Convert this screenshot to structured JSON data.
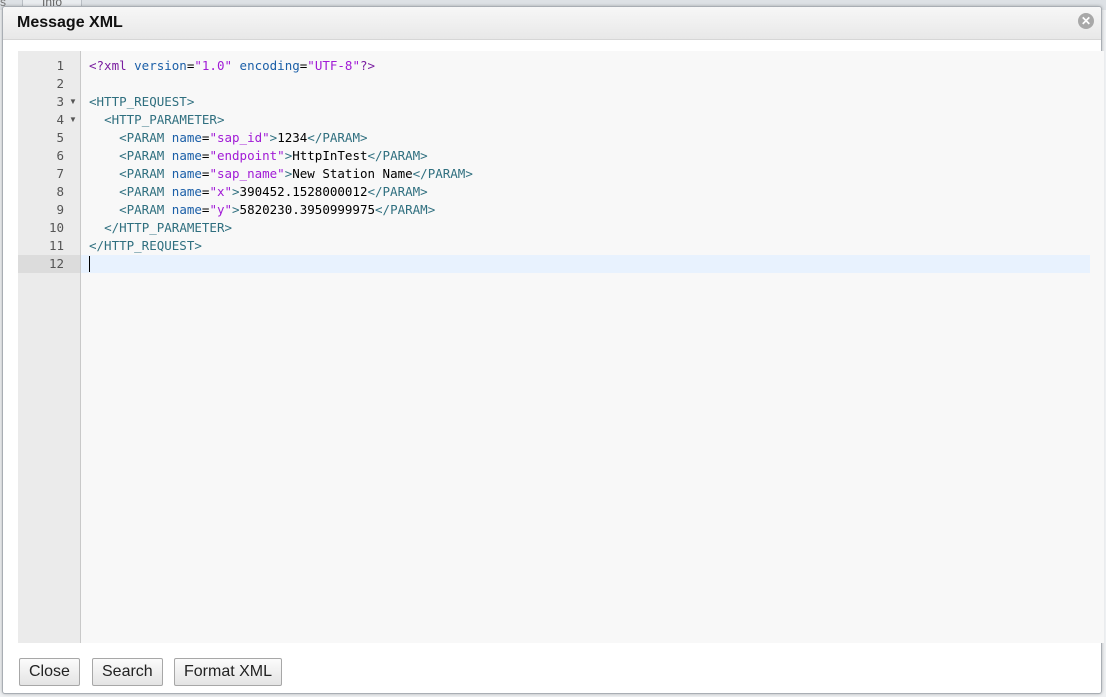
{
  "background": {
    "tab_fragment": "Info",
    "left_fragment": "s"
  },
  "dialog": {
    "title": "Message XML",
    "close_icon": "close-circle-icon"
  },
  "editor": {
    "active_line": 12,
    "lines": [
      {
        "n": "1",
        "fold": "",
        "tokens": [
          [
            "xml",
            "<?xml "
          ],
          [
            "attr",
            "version"
          ],
          [
            "txt",
            "="
          ],
          [
            "str",
            "\"1.0\""
          ],
          [
            "txt",
            " "
          ],
          [
            "attr",
            "encoding"
          ],
          [
            "txt",
            "="
          ],
          [
            "str",
            "\"UTF-8\""
          ],
          [
            "xml",
            "?>"
          ]
        ]
      },
      {
        "n": "2",
        "fold": "",
        "tokens": []
      },
      {
        "n": "3",
        "fold": "▼",
        "tokens": [
          [
            "tag",
            "<HTTP_REQUEST>"
          ]
        ]
      },
      {
        "n": "4",
        "fold": "▼",
        "tokens": [
          [
            "txt",
            "  "
          ],
          [
            "tag",
            "<HTTP_PARAMETER>"
          ]
        ]
      },
      {
        "n": "5",
        "fold": "",
        "tokens": [
          [
            "txt",
            "    "
          ],
          [
            "tag",
            "<PARAM "
          ],
          [
            "attr",
            "name"
          ],
          [
            "txt",
            "="
          ],
          [
            "str",
            "\"sap_id\""
          ],
          [
            "tag",
            ">"
          ],
          [
            "txt",
            "1234"
          ],
          [
            "tag",
            "</PARAM>"
          ]
        ]
      },
      {
        "n": "6",
        "fold": "",
        "tokens": [
          [
            "txt",
            "    "
          ],
          [
            "tag",
            "<PARAM "
          ],
          [
            "attr",
            "name"
          ],
          [
            "txt",
            "="
          ],
          [
            "str",
            "\"endpoint\""
          ],
          [
            "tag",
            ">"
          ],
          [
            "txt",
            "HttpInTest"
          ],
          [
            "tag",
            "</PARAM>"
          ]
        ]
      },
      {
        "n": "7",
        "fold": "",
        "tokens": [
          [
            "txt",
            "    "
          ],
          [
            "tag",
            "<PARAM "
          ],
          [
            "attr",
            "name"
          ],
          [
            "txt",
            "="
          ],
          [
            "str",
            "\"sap_name\""
          ],
          [
            "tag",
            ">"
          ],
          [
            "txt",
            "New Station Name"
          ],
          [
            "tag",
            "</PARAM>"
          ]
        ]
      },
      {
        "n": "8",
        "fold": "",
        "tokens": [
          [
            "txt",
            "    "
          ],
          [
            "tag",
            "<PARAM "
          ],
          [
            "attr",
            "name"
          ],
          [
            "txt",
            "="
          ],
          [
            "str",
            "\"x\""
          ],
          [
            "tag",
            ">"
          ],
          [
            "txt",
            "390452.1528000012"
          ],
          [
            "tag",
            "</PARAM>"
          ]
        ]
      },
      {
        "n": "9",
        "fold": "",
        "tokens": [
          [
            "txt",
            "    "
          ],
          [
            "tag",
            "<PARAM "
          ],
          [
            "attr",
            "name"
          ],
          [
            "txt",
            "="
          ],
          [
            "str",
            "\"y\""
          ],
          [
            "tag",
            ">"
          ],
          [
            "txt",
            "5820230.3950999975"
          ],
          [
            "tag",
            "</PARAM>"
          ]
        ]
      },
      {
        "n": "10",
        "fold": "",
        "tokens": [
          [
            "txt",
            "  "
          ],
          [
            "tag",
            "</HTTP_PARAMETER>"
          ]
        ]
      },
      {
        "n": "11",
        "fold": "",
        "tokens": [
          [
            "tag",
            "</HTTP_REQUEST>"
          ]
        ]
      },
      {
        "n": "12",
        "fold": "",
        "tokens": []
      }
    ]
  },
  "buttons": {
    "close_label": "Close",
    "search_label": "Search",
    "format_label": "Format XML"
  },
  "colors": {
    "tag": "#2f6f7f",
    "attr": "#1b5fa8",
    "string": "#a11bd6",
    "active_line": "#e8f2fe"
  }
}
